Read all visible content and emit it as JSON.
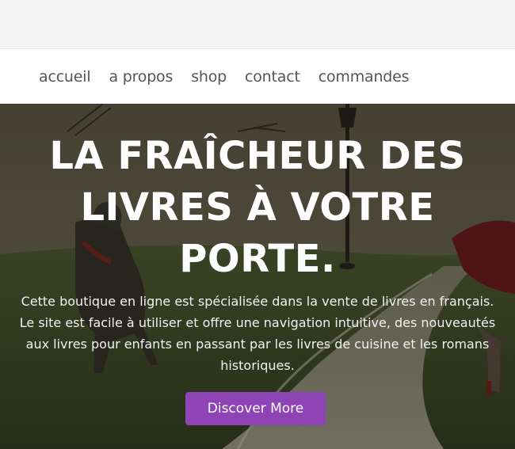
{
  "nav": {
    "items": [
      {
        "label": "accueil"
      },
      {
        "label": "a propos"
      },
      {
        "label": "shop"
      },
      {
        "label": "contact"
      },
      {
        "label": "commandes"
      }
    ]
  },
  "hero": {
    "title": "LA FRAÎCHEUR DES LIVRES À VOTRE PORTE.",
    "description": "Cette boutique en ligne est spécialisée dans la vente de livres en français. Le site est facile à utiliser et offre une navigation intuitive, des nouveautés aux livres pour enfants en passant par les livres de cuisine et les romans historiques.",
    "cta_label": "Discover More"
  },
  "colors": {
    "accent": "#8e44b5",
    "nav_text": "#555555",
    "hero_text": "#ffffff"
  }
}
